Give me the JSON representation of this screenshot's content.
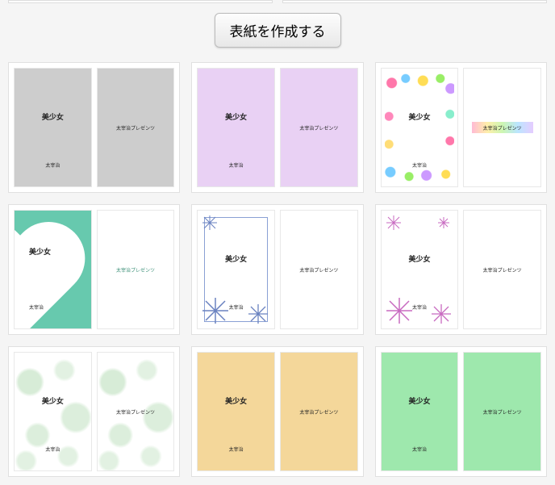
{
  "button": {
    "create": "表紙を作成する"
  },
  "common": {
    "title": "美少女",
    "author": "太宰治",
    "back": "太宰治プレゼンツ"
  }
}
